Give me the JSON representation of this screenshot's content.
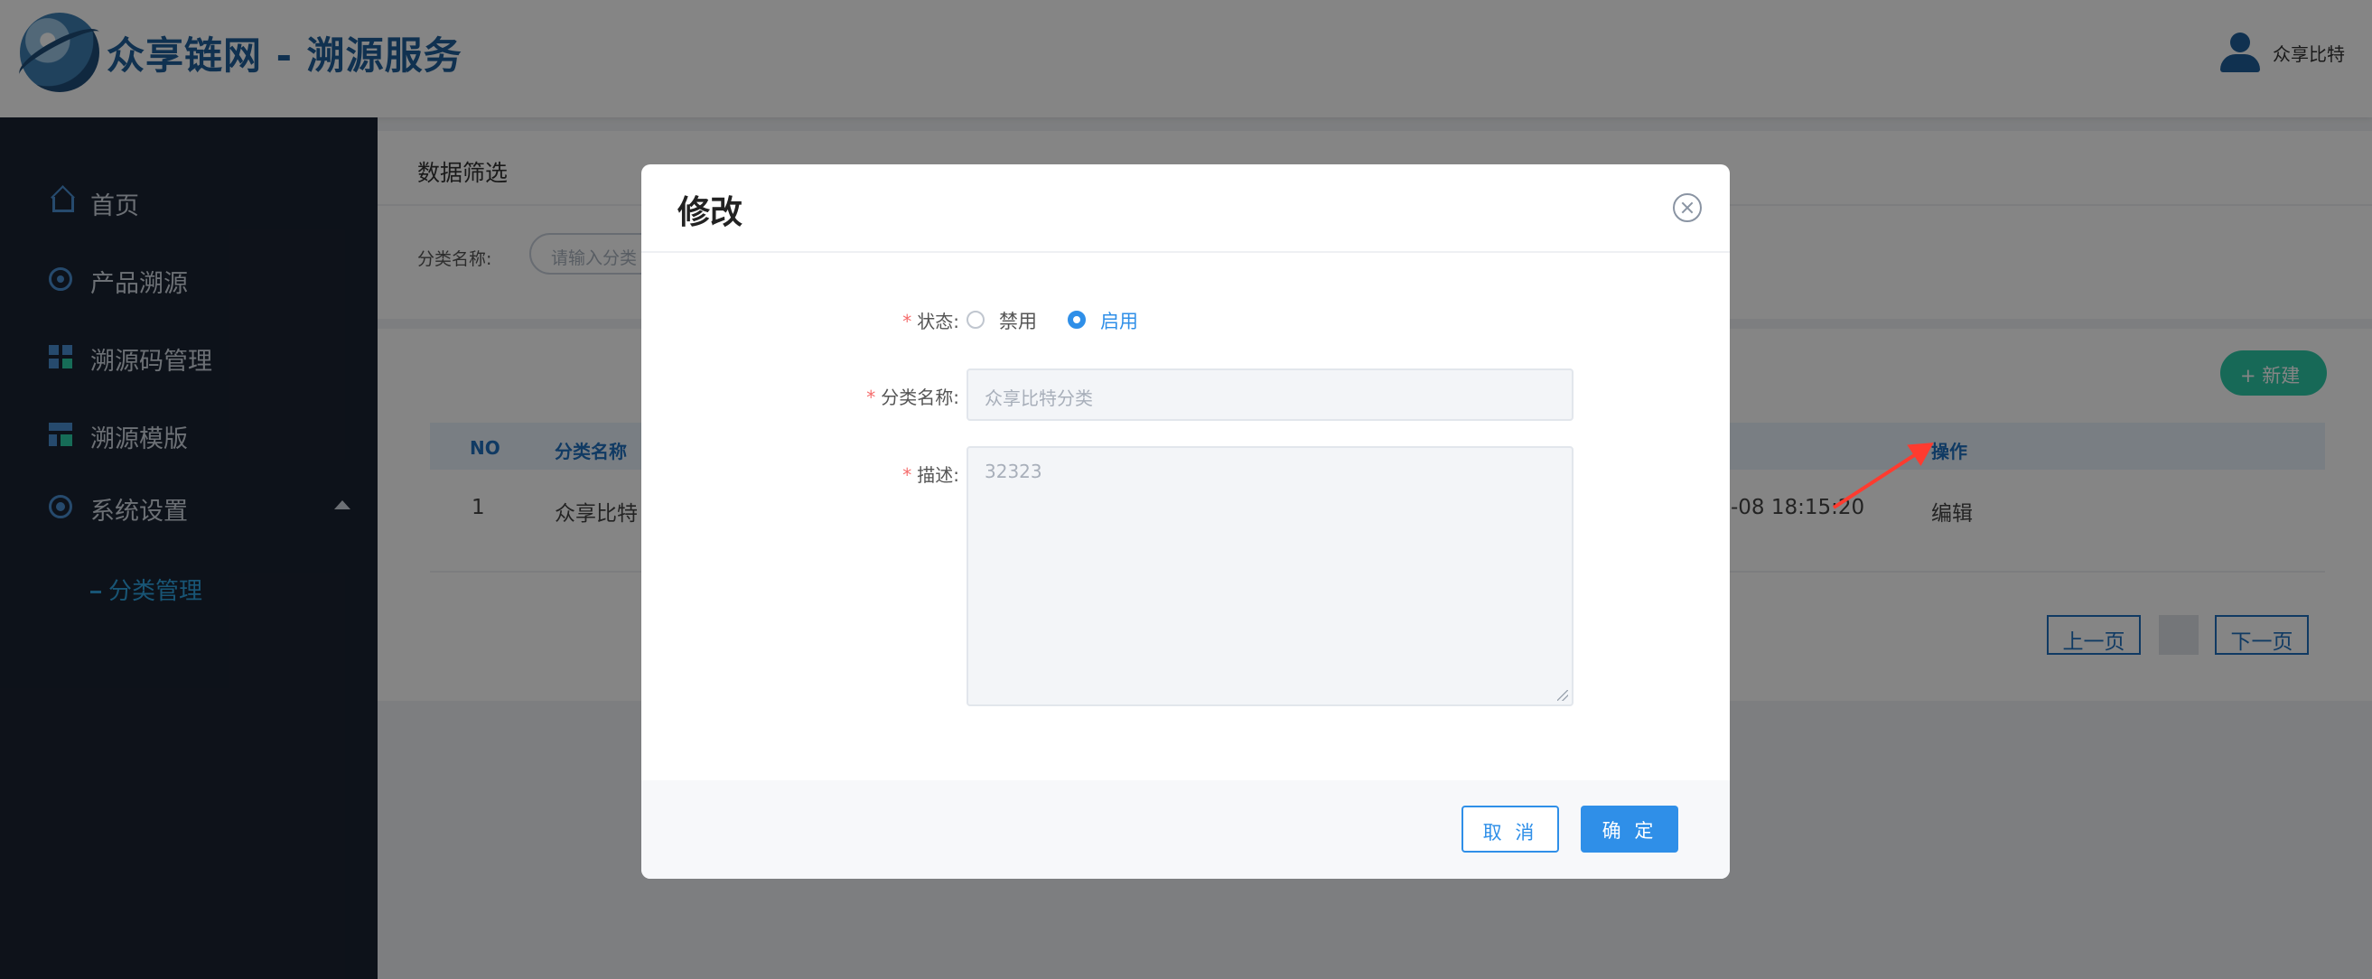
{
  "header": {
    "title": "众享链网 - 溯源服务",
    "user_name": "众享比特"
  },
  "sidebar": {
    "items": [
      {
        "label": "首页",
        "icon": "home-icon"
      },
      {
        "label": "产品溯源",
        "icon": "target-icon"
      },
      {
        "label": "溯源码管理",
        "icon": "qrcode-icon"
      },
      {
        "label": "溯源模版",
        "icon": "template-icon"
      },
      {
        "label": "系统设置",
        "icon": "settings-icon",
        "expanded": true
      }
    ],
    "sub_items": [
      {
        "label": "分类管理",
        "active": true
      }
    ]
  },
  "filter": {
    "title": "数据筛选",
    "category_label": "分类名称:",
    "category_placeholder": "请输入分类"
  },
  "list": {
    "new_button": "+ 新建",
    "columns": [
      "NO",
      "分类名称",
      "操作"
    ],
    "rows": [
      {
        "no": "1",
        "name": "众享比特",
        "time": "-08 18:15:20",
        "action": "编辑"
      }
    ],
    "pager": {
      "prev": "上一页",
      "next": "下一页"
    }
  },
  "modal": {
    "title": "修改",
    "status_label": "状态:",
    "status_options": [
      {
        "label": "禁用",
        "selected": false
      },
      {
        "label": "启用",
        "selected": true
      }
    ],
    "name_label": "分类名称:",
    "name_value": "众享比特分类",
    "desc_label": "描述:",
    "desc_value": "32323",
    "cancel_label": "取 消",
    "ok_label": "确 定"
  },
  "colors": {
    "brand": "#1f5f99",
    "sidebar_bg": "#1a2332",
    "primary": "#2f8fe8",
    "accent_green": "#2cc9a8",
    "annotation_arrow": "#ff3b2f"
  }
}
